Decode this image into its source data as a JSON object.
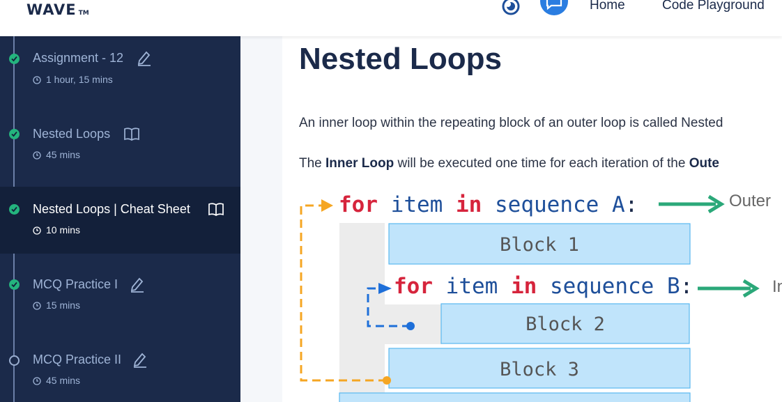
{
  "header": {
    "logo": "WAVE",
    "logo_tm": "TM",
    "nav": {
      "home": "Home",
      "code_playground": "Code Playground"
    },
    "icons": [
      "theme-toggle-icon",
      "chat-icon"
    ]
  },
  "sidebar": {
    "items": [
      {
        "title": "Assignment - 12",
        "duration": "1 hour, 15 mins",
        "status": "completed",
        "type": "assignment",
        "icon": "edit-icon"
      },
      {
        "title": "Nested Loops",
        "duration": "45 mins",
        "status": "completed",
        "type": "reading",
        "icon": "book-icon"
      },
      {
        "title": "Nested Loops | Cheat Sheet",
        "duration": "10 mins",
        "status": "completed",
        "type": "reading",
        "icon": "book-icon",
        "active": true
      },
      {
        "title": "MCQ Practice I",
        "duration": "15 mins",
        "status": "completed",
        "type": "practice",
        "icon": "edit-icon"
      },
      {
        "title": "MCQ Practice II",
        "duration": "45 mins",
        "status": "not-started",
        "type": "practice",
        "icon": "edit-icon"
      }
    ]
  },
  "content": {
    "title": "Nested Loops",
    "para1": "An inner loop within the repeating block of an outer loop is called Nested",
    "para2": {
      "t1": "The ",
      "b1": "Inner Loop",
      "t2": " will be executed one time for each iteration of the ",
      "b2": "Oute"
    },
    "diagram": {
      "outer_line": {
        "kw1": "for",
        "var": "item",
        "kw2": "in",
        "seq": "sequence A",
        "colon": ":"
      },
      "inner_line": {
        "kw1": "for",
        "var": "item",
        "kw2": "in",
        "seq": "sequence B",
        "colon": ":"
      },
      "block1": "Block 1",
      "block2": "Block 2",
      "block3": "Block 3",
      "outer_note": "Outer",
      "inner_note": "In"
    }
  },
  "colors": {
    "sidebar_bg": "#1b2a4a",
    "sidebar_active": "#13203a",
    "completed": "#24b47e",
    "keyword": "#d6243c",
    "identifier": "#1e4f9a",
    "block_fill": "#c0e4fb",
    "outer_arrow": "#f5a623",
    "inner_arrow": "#1e6fd9",
    "note_arrow": "#2ba879"
  }
}
